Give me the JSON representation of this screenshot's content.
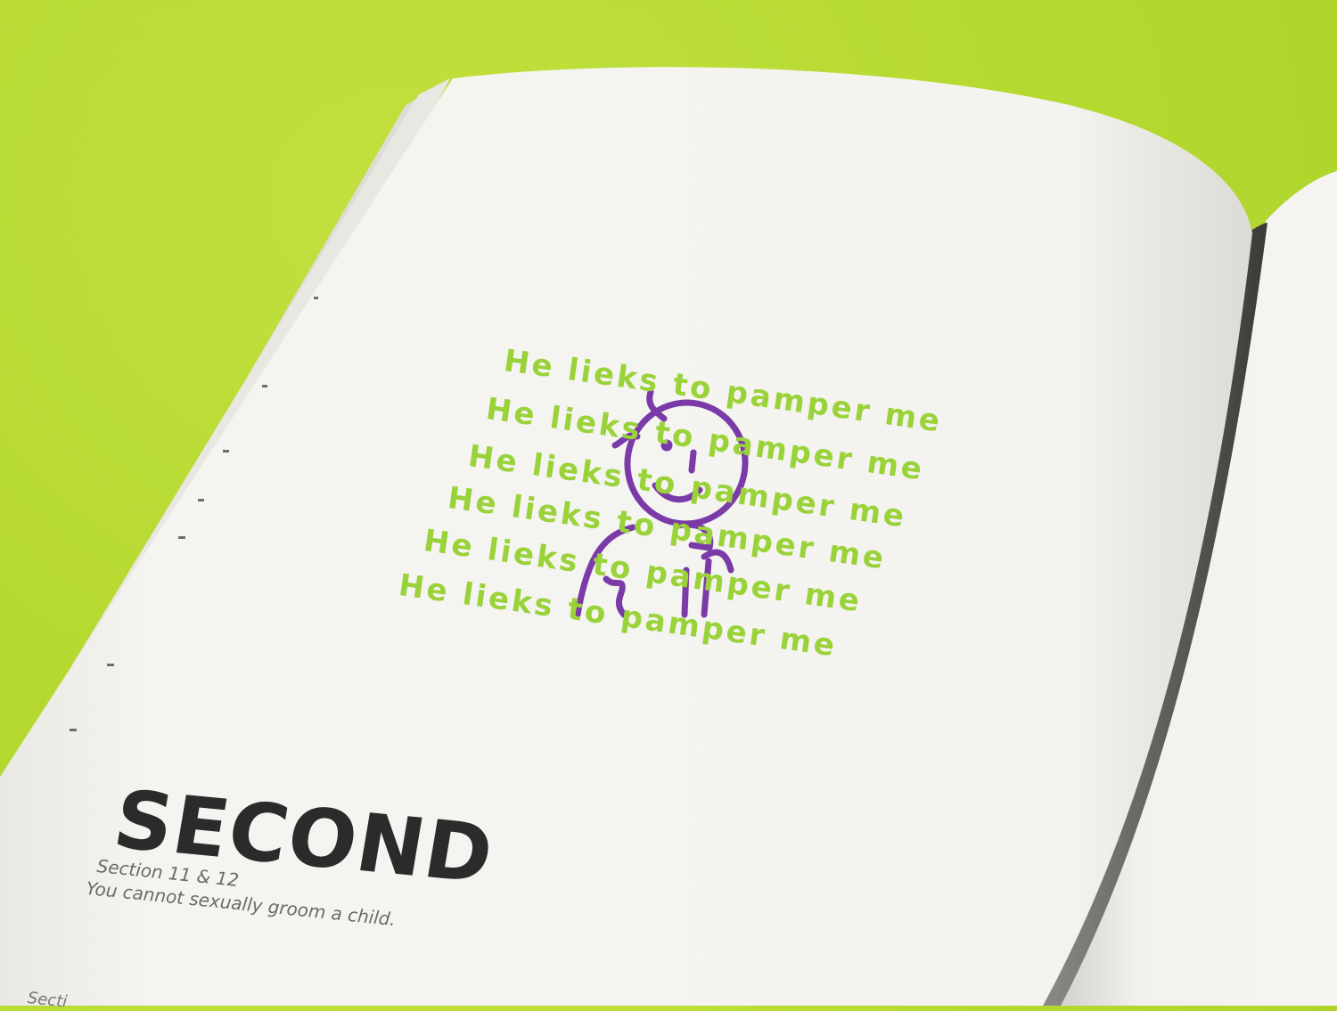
{
  "page": {
    "background_color": "#b4d82f",
    "paper_color": "#f4f3ef"
  },
  "drawing": {
    "lines": [
      "He lieks to pamper me",
      "He lieks to pamper me",
      "He lieks to pamper me",
      "He lieks to pamper me",
      "He lieks to pamper me",
      "He lieks to pamper me"
    ],
    "text_color": "#9ad23a",
    "figure_color": "#7a3aa8",
    "figure": "stick-figure"
  },
  "heading": {
    "title": "SECOND",
    "section": "Section 11 & 12",
    "statement": "You cannot sexually groom a child.",
    "bottom_fragment": "Secti"
  }
}
